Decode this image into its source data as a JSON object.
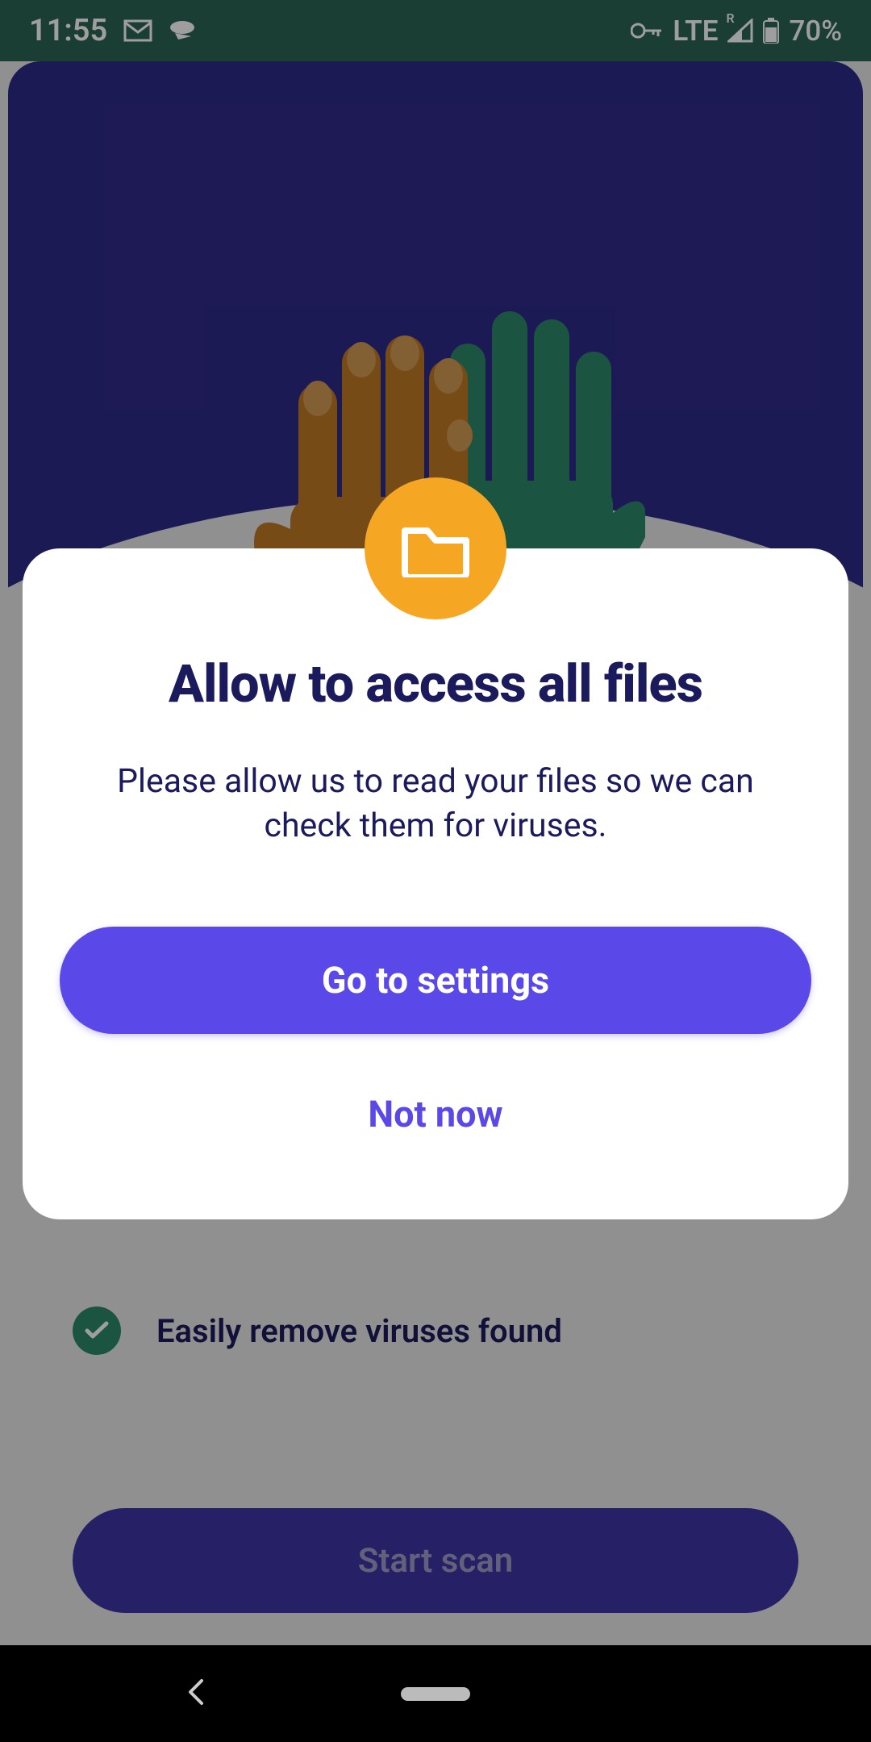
{
  "status": {
    "time": "11:55",
    "network_type": "LTE",
    "signal_superscript": "R",
    "battery_percent": "70%"
  },
  "background": {
    "feature_text": "Easily remove viruses found",
    "start_scan_label": "Start scan"
  },
  "dialog": {
    "title": "Allow to access all files",
    "body": "Please allow us to read your files so we can check them for viruses.",
    "primary_label": "Go to settings",
    "secondary_label": "Not now"
  }
}
